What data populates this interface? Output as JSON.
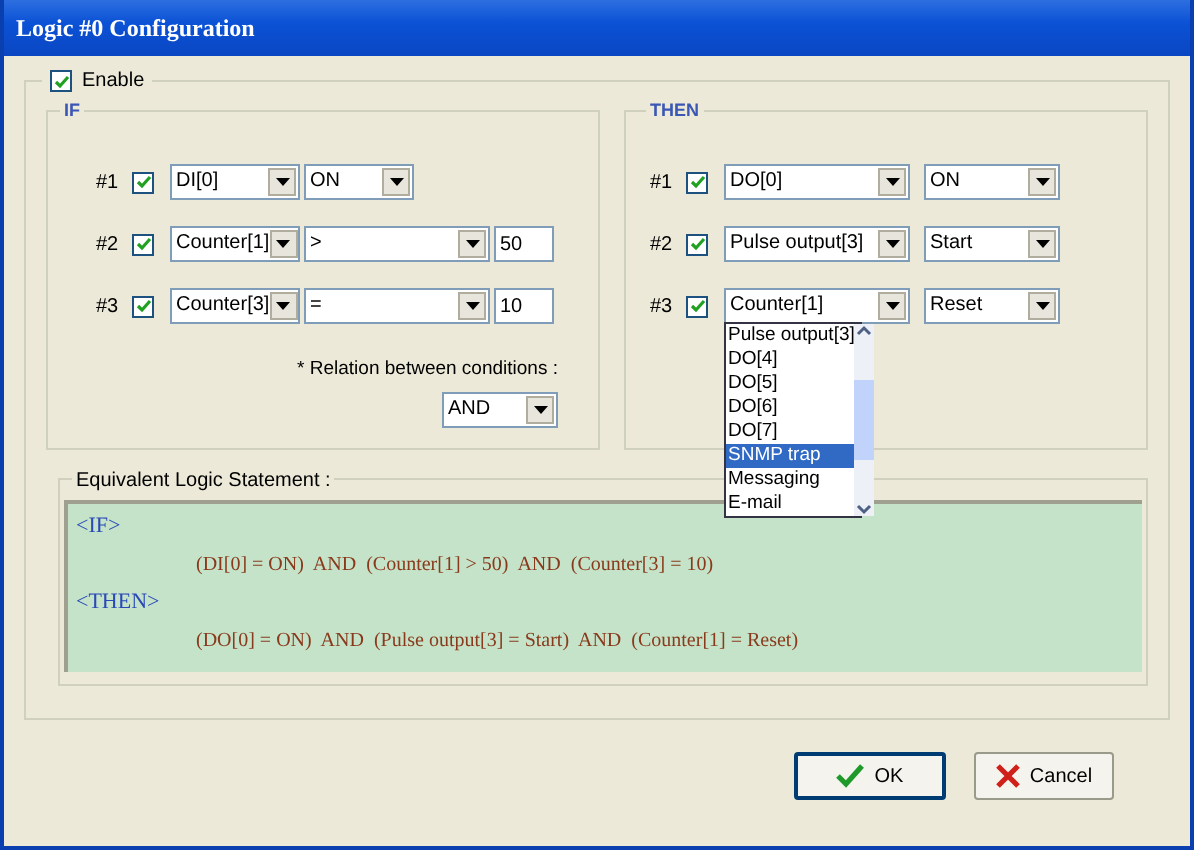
{
  "window": {
    "title": "Logic #0 Configuration"
  },
  "enable": {
    "label": "Enable",
    "checked": true
  },
  "if": {
    "title": "IF",
    "conditions": [
      {
        "label": "#1",
        "checked": true,
        "source": "DI[0]",
        "operator": "ON"
      },
      {
        "label": "#2",
        "checked": true,
        "source": "Counter[1]",
        "operator": ">",
        "value": "50"
      },
      {
        "label": "#3",
        "checked": true,
        "source": "Counter[3]",
        "operator": "=",
        "value": "10"
      }
    ],
    "relation_label": "* Relation between conditions :",
    "relation": "AND"
  },
  "then": {
    "title": "THEN",
    "actions": [
      {
        "label": "#1",
        "checked": true,
        "target": "DO[0]",
        "action": "ON",
        "expanded": false
      },
      {
        "label": "#2",
        "checked": true,
        "target": "Pulse output[3]",
        "action": "Start",
        "expanded": false
      },
      {
        "label": "#3",
        "checked": true,
        "target": "Counter[1]",
        "action": "Reset",
        "expanded": true
      }
    ],
    "options": [
      {
        "label": "Pulse output[3]",
        "selected": false
      },
      {
        "label": "DO[4]",
        "selected": false
      },
      {
        "label": "DO[5]",
        "selected": false
      },
      {
        "label": "DO[6]",
        "selected": false
      },
      {
        "label": "DO[7]",
        "selected": false
      },
      {
        "label": "SNMP trap",
        "selected": true
      },
      {
        "label": "Messaging",
        "selected": false
      },
      {
        "label": "E-mail",
        "selected": false
      }
    ]
  },
  "statement": {
    "title": "Equivalent Logic Statement :",
    "lines": [
      {
        "kind": "keyword",
        "text": "<IF>"
      },
      {
        "kind": "expression",
        "text": "(DI[0] = ON)  AND  (Counter[1] > 50)  AND  (Counter[3] = 10)"
      },
      {
        "kind": "keyword",
        "text": "<THEN>"
      },
      {
        "kind": "expression",
        "text": "(DO[0] = ON)  AND  (Pulse output[3] = Start)  AND  (Counter[1] = Reset)"
      }
    ]
  },
  "buttons": [
    {
      "kind": "ok",
      "label": "OK"
    },
    {
      "kind": "cancel",
      "label": "Cancel"
    }
  ]
}
